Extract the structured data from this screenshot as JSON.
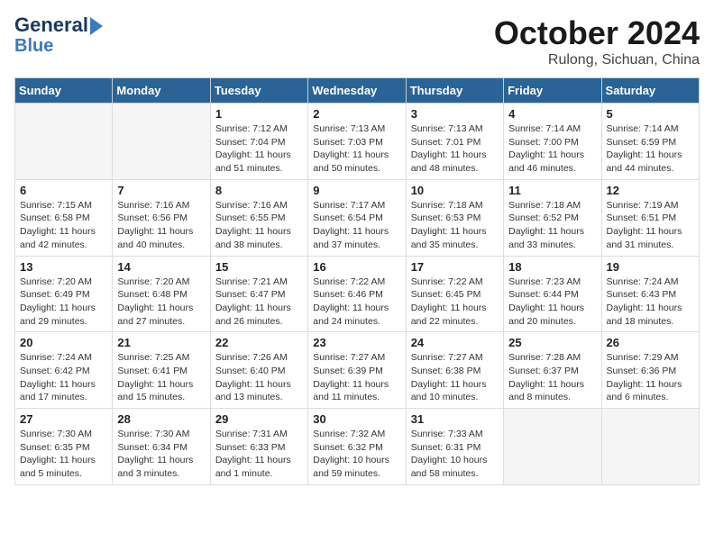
{
  "logo": {
    "line1": "General",
    "line2": "Blue"
  },
  "title": "October 2024",
  "location": "Rulong, Sichuan, China",
  "days_header": [
    "Sunday",
    "Monday",
    "Tuesday",
    "Wednesday",
    "Thursday",
    "Friday",
    "Saturday"
  ],
  "weeks": [
    [
      {
        "day": "",
        "content": ""
      },
      {
        "day": "",
        "content": ""
      },
      {
        "day": "1",
        "content": "Sunrise: 7:12 AM\nSunset: 7:04 PM\nDaylight: 11 hours\nand 51 minutes."
      },
      {
        "day": "2",
        "content": "Sunrise: 7:13 AM\nSunset: 7:03 PM\nDaylight: 11 hours\nand 50 minutes."
      },
      {
        "day": "3",
        "content": "Sunrise: 7:13 AM\nSunset: 7:01 PM\nDaylight: 11 hours\nand 48 minutes."
      },
      {
        "day": "4",
        "content": "Sunrise: 7:14 AM\nSunset: 7:00 PM\nDaylight: 11 hours\nand 46 minutes."
      },
      {
        "day": "5",
        "content": "Sunrise: 7:14 AM\nSunset: 6:59 PM\nDaylight: 11 hours\nand 44 minutes."
      }
    ],
    [
      {
        "day": "6",
        "content": "Sunrise: 7:15 AM\nSunset: 6:58 PM\nDaylight: 11 hours\nand 42 minutes."
      },
      {
        "day": "7",
        "content": "Sunrise: 7:16 AM\nSunset: 6:56 PM\nDaylight: 11 hours\nand 40 minutes."
      },
      {
        "day": "8",
        "content": "Sunrise: 7:16 AM\nSunset: 6:55 PM\nDaylight: 11 hours\nand 38 minutes."
      },
      {
        "day": "9",
        "content": "Sunrise: 7:17 AM\nSunset: 6:54 PM\nDaylight: 11 hours\nand 37 minutes."
      },
      {
        "day": "10",
        "content": "Sunrise: 7:18 AM\nSunset: 6:53 PM\nDaylight: 11 hours\nand 35 minutes."
      },
      {
        "day": "11",
        "content": "Sunrise: 7:18 AM\nSunset: 6:52 PM\nDaylight: 11 hours\nand 33 minutes."
      },
      {
        "day": "12",
        "content": "Sunrise: 7:19 AM\nSunset: 6:51 PM\nDaylight: 11 hours\nand 31 minutes."
      }
    ],
    [
      {
        "day": "13",
        "content": "Sunrise: 7:20 AM\nSunset: 6:49 PM\nDaylight: 11 hours\nand 29 minutes."
      },
      {
        "day": "14",
        "content": "Sunrise: 7:20 AM\nSunset: 6:48 PM\nDaylight: 11 hours\nand 27 minutes."
      },
      {
        "day": "15",
        "content": "Sunrise: 7:21 AM\nSunset: 6:47 PM\nDaylight: 11 hours\nand 26 minutes."
      },
      {
        "day": "16",
        "content": "Sunrise: 7:22 AM\nSunset: 6:46 PM\nDaylight: 11 hours\nand 24 minutes."
      },
      {
        "day": "17",
        "content": "Sunrise: 7:22 AM\nSunset: 6:45 PM\nDaylight: 11 hours\nand 22 minutes."
      },
      {
        "day": "18",
        "content": "Sunrise: 7:23 AM\nSunset: 6:44 PM\nDaylight: 11 hours\nand 20 minutes."
      },
      {
        "day": "19",
        "content": "Sunrise: 7:24 AM\nSunset: 6:43 PM\nDaylight: 11 hours\nand 18 minutes."
      }
    ],
    [
      {
        "day": "20",
        "content": "Sunrise: 7:24 AM\nSunset: 6:42 PM\nDaylight: 11 hours\nand 17 minutes."
      },
      {
        "day": "21",
        "content": "Sunrise: 7:25 AM\nSunset: 6:41 PM\nDaylight: 11 hours\nand 15 minutes."
      },
      {
        "day": "22",
        "content": "Sunrise: 7:26 AM\nSunset: 6:40 PM\nDaylight: 11 hours\nand 13 minutes."
      },
      {
        "day": "23",
        "content": "Sunrise: 7:27 AM\nSunset: 6:39 PM\nDaylight: 11 hours\nand 11 minutes."
      },
      {
        "day": "24",
        "content": "Sunrise: 7:27 AM\nSunset: 6:38 PM\nDaylight: 11 hours\nand 10 minutes."
      },
      {
        "day": "25",
        "content": "Sunrise: 7:28 AM\nSunset: 6:37 PM\nDaylight: 11 hours\nand 8 minutes."
      },
      {
        "day": "26",
        "content": "Sunrise: 7:29 AM\nSunset: 6:36 PM\nDaylight: 11 hours\nand 6 minutes."
      }
    ],
    [
      {
        "day": "27",
        "content": "Sunrise: 7:30 AM\nSunset: 6:35 PM\nDaylight: 11 hours\nand 5 minutes."
      },
      {
        "day": "28",
        "content": "Sunrise: 7:30 AM\nSunset: 6:34 PM\nDaylight: 11 hours\nand 3 minutes."
      },
      {
        "day": "29",
        "content": "Sunrise: 7:31 AM\nSunset: 6:33 PM\nDaylight: 11 hours\nand 1 minute."
      },
      {
        "day": "30",
        "content": "Sunrise: 7:32 AM\nSunset: 6:32 PM\nDaylight: 10 hours\nand 59 minutes."
      },
      {
        "day": "31",
        "content": "Sunrise: 7:33 AM\nSunset: 6:31 PM\nDaylight: 10 hours\nand 58 minutes."
      },
      {
        "day": "",
        "content": ""
      },
      {
        "day": "",
        "content": ""
      }
    ]
  ]
}
